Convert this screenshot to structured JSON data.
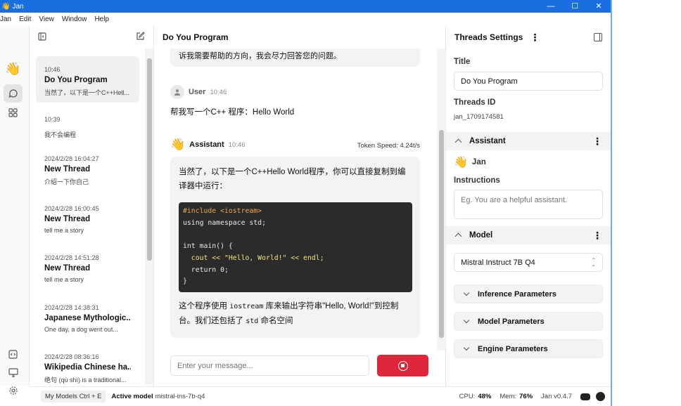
{
  "window": {
    "title": "Jan",
    "app_icon": "👋",
    "minimize": "—",
    "maximize": "☐",
    "close": "✕"
  },
  "menu": [
    "Jan",
    "Edit",
    "View",
    "Window",
    "Help"
  ],
  "iconbar": {
    "logo": "👋",
    "items": [
      "chat-icon",
      "grid-icon"
    ],
    "bottom": [
      "code-icon",
      "monitor-icon",
      "gear-icon"
    ]
  },
  "threads": {
    "items": [
      {
        "time": "10:46",
        "name": "Do You Program",
        "snippet": "当然了，以下是一个C++Hell...",
        "active": true
      },
      {
        "time": "10:39",
        "name": "",
        "snippet": "我不会编程",
        "active": false
      },
      {
        "time": "2024/2/28 16:04:27",
        "name": "New Thread",
        "snippet": "介绍一下你自己",
        "active": false
      },
      {
        "time": "2024/2/28 16:00:45",
        "name": "New Thread",
        "snippet": "tell me a story",
        "active": false
      },
      {
        "time": "2024/2/28 14:51:28",
        "name": "New Thread",
        "snippet": "tell me a story",
        "active": false
      },
      {
        "time": "2024/2/28 14:38:31",
        "name": "Japanese Mythologic...",
        "snippet": "One day, a dog went out...",
        "active": false
      },
      {
        "time": "2024/2/28 08:36:16",
        "name": "Wikipedia Chinese ha...",
        "snippet": "绝句 (qù shì) is a traditional...",
        "active": false
      }
    ]
  },
  "chat": {
    "title": "Do You Program",
    "prev_text": "诉我需要帮助的方向，我会尽力回答您的问题。",
    "user": {
      "name": "User",
      "time": "10:46",
      "text": "帮我写一个C++ 程序：Hello World"
    },
    "assistant": {
      "icon": "👋",
      "name": "Assistant",
      "time": "10:46",
      "token_speed": "Token Speed: 4.24t/s",
      "intro": "当然了，以下是一个C++Hello World程序，你可以直接复制到编译器中运行：",
      "code_lines": [
        "#include <iostream>",
        "using namespace std;",
        "",
        "int main() {",
        "  cout << \"Hello, World!\" << endl;",
        "  return 0;",
        "}"
      ],
      "after_1": "这个程序使用 ",
      "after_code_1": "iostream",
      "after_2": " 库来输出字符串\"Hello, World!\"到控制台。我们还包括了 ",
      "after_code_2": "std",
      "after_3": " 命名空间"
    },
    "input_placeholder": "Enter your message..."
  },
  "settings": {
    "title": "Threads Settings",
    "title_label": "Title",
    "title_value": "Do You Program",
    "thread_id_label": "Threads ID",
    "thread_id_value": "jan_1709174581",
    "assistant_section": "Assistant",
    "assistant_icon": "👋",
    "assistant_name": "Jan",
    "instructions_label": "Instructions",
    "instructions_placeholder": "Eg. You are a helpful assistant.",
    "model_section": "Model",
    "model_value": "Mistral Instruct 7B Q4",
    "inference": "Inference Parameters",
    "model_params": "Model Parameters",
    "engine_params": "Engine Parameters"
  },
  "status": {
    "my_models": "My Models Ctrl + E",
    "active_label": "Active model",
    "active_value": "mistral-ins-7b-q4",
    "cpu_label": "CPU:",
    "cpu_value": "48%",
    "mem_label": "Mem:",
    "mem_value": "76%",
    "version": "Jan v0.4.7"
  }
}
